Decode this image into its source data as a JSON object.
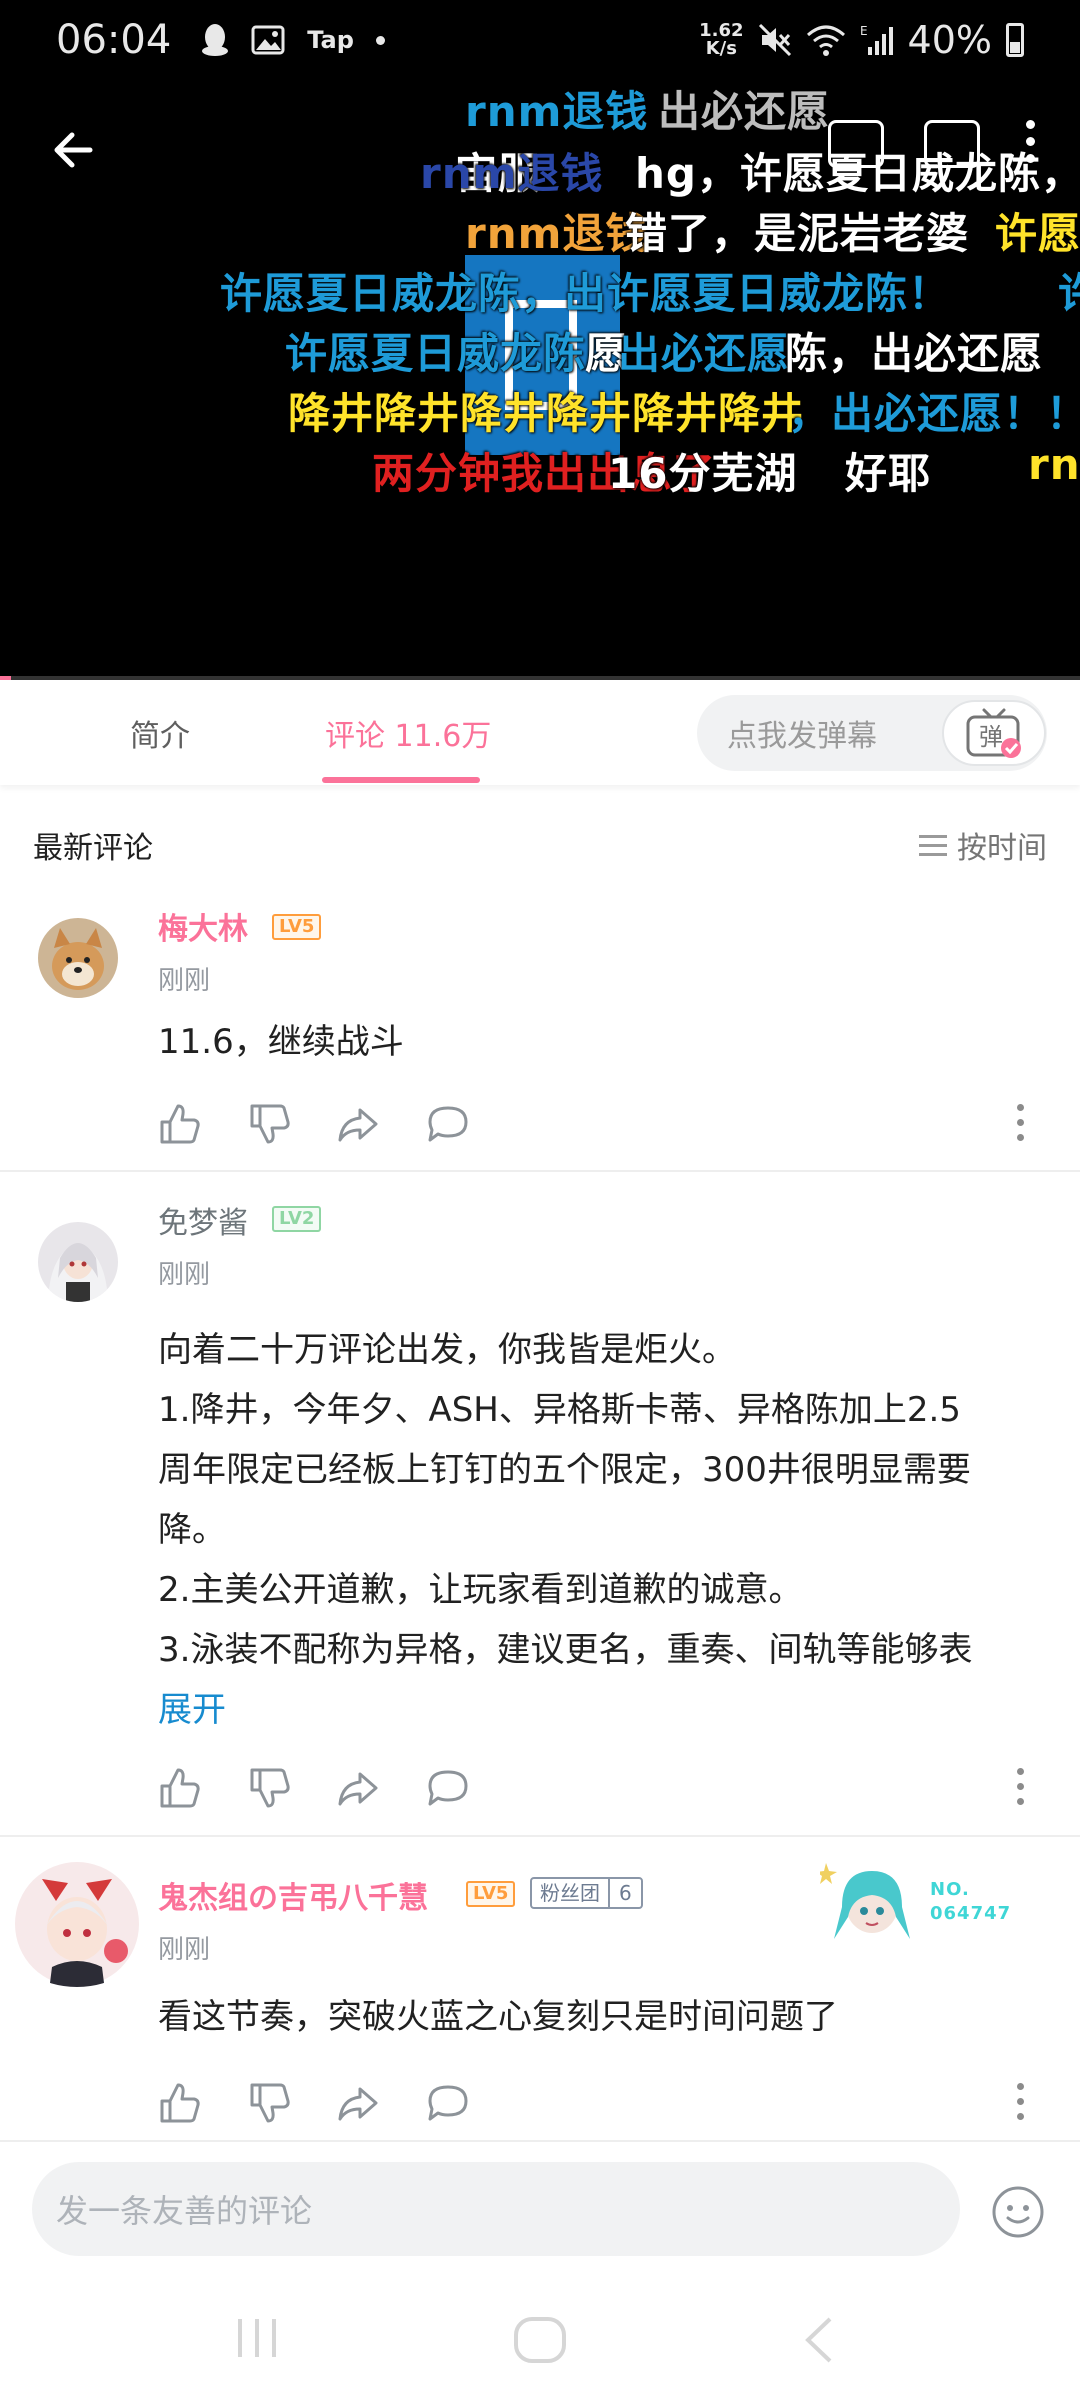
{
  "status_bar": {
    "time": "06:04",
    "left_icons": [
      "qq-icon",
      "gallery-icon",
      "tap-icon",
      "dot-icon"
    ],
    "tap_label": "Tap",
    "net_speed_value": "1.62",
    "net_speed_unit": "K/s",
    "wifi_label": "E",
    "battery": "40%"
  },
  "player": {
    "progress_fraction": 0.01,
    "danmaku": [
      {
        "text": "rnm退钱",
        "color": "blue"
      },
      {
        "text": "出必还愿",
        "color": "gray"
      },
      {
        "text": "宙服",
        "color": "white"
      },
      {
        "text": "rnm退钱",
        "color": "navy"
      },
      {
        "text": "hg，许愿夏日威龙陈，出",
        "color": "white"
      },
      {
        "text": "rnm退钱",
        "color": "orange"
      },
      {
        "text": "错了，是泥岩老婆",
        "color": "white"
      },
      {
        "text": "许愿",
        "color": "yellow"
      },
      {
        "text": "许愿夏日威龙陈，出许愿夏日威龙陈！",
        "color": "blue"
      },
      {
        "text": "许",
        "color": "blue"
      },
      {
        "text": "许愿夏日威龙陈",
        "color": "blue"
      },
      {
        "text": "愿",
        "color": "white"
      },
      {
        "text": "出必还愿",
        "color": "blue"
      },
      {
        "text": "陈，出必还愿",
        "color": "white"
      },
      {
        "text": "降井降井降井降井降井降井",
        "color": "yellow"
      },
      {
        "text": "，出必还愿！！",
        "color": "blue"
      },
      {
        "text": "两分钟我出出息了",
        "color": "red"
      },
      {
        "text": "16分芜湖",
        "color": "white"
      },
      {
        "text": "好耶",
        "color": "white"
      },
      {
        "text": "rnm",
        "color": "yellow"
      }
    ]
  },
  "tabs": {
    "intro": "简介",
    "comments": "评论 11.6万",
    "danmaku_placeholder": "点我发弹幕",
    "danmaku_button": "弹"
  },
  "comments_header": {
    "title": "最新评论",
    "sort": "按时间"
  },
  "comments": [
    {
      "user": "梅大林",
      "level": "LV5",
      "time": "刚刚",
      "lines": [
        "11.6，继续战斗"
      ]
    },
    {
      "user": "免梦酱",
      "level": "LV2",
      "time": "刚刚",
      "lines": [
        "向着二十万评论出发，你我皆是炬火。",
        "1.降井，今年夕、ASH、异格斯卡蒂、异格陈加上2.5",
        "周年限定已经板上钉钉的五个限定，300井很明显需要",
        "降。",
        "2.主美公开道歉，让玩家看到道歉的诚意。",
        "3.泳装不配称为异格，建议更名，重奏、间轨等能够表"
      ],
      "expand": "展开"
    },
    {
      "user": "鬼杰组の吉弔八千慧",
      "level": "LV5",
      "fan_badge_name": "粉丝团",
      "fan_badge_level": "6",
      "deco_line1": "NO.",
      "deco_line2": "064747",
      "time": "刚刚",
      "lines": [
        "看这节奏，突破火蓝之心复刻只是时间问题了"
      ]
    }
  ],
  "reply": {
    "placeholder": "发一条友善的评论"
  },
  "colors": {
    "accent": "#fb7299",
    "link": "#178bcf",
    "lv5": "#ff9d3c",
    "lv2": "#8fd6a3"
  }
}
